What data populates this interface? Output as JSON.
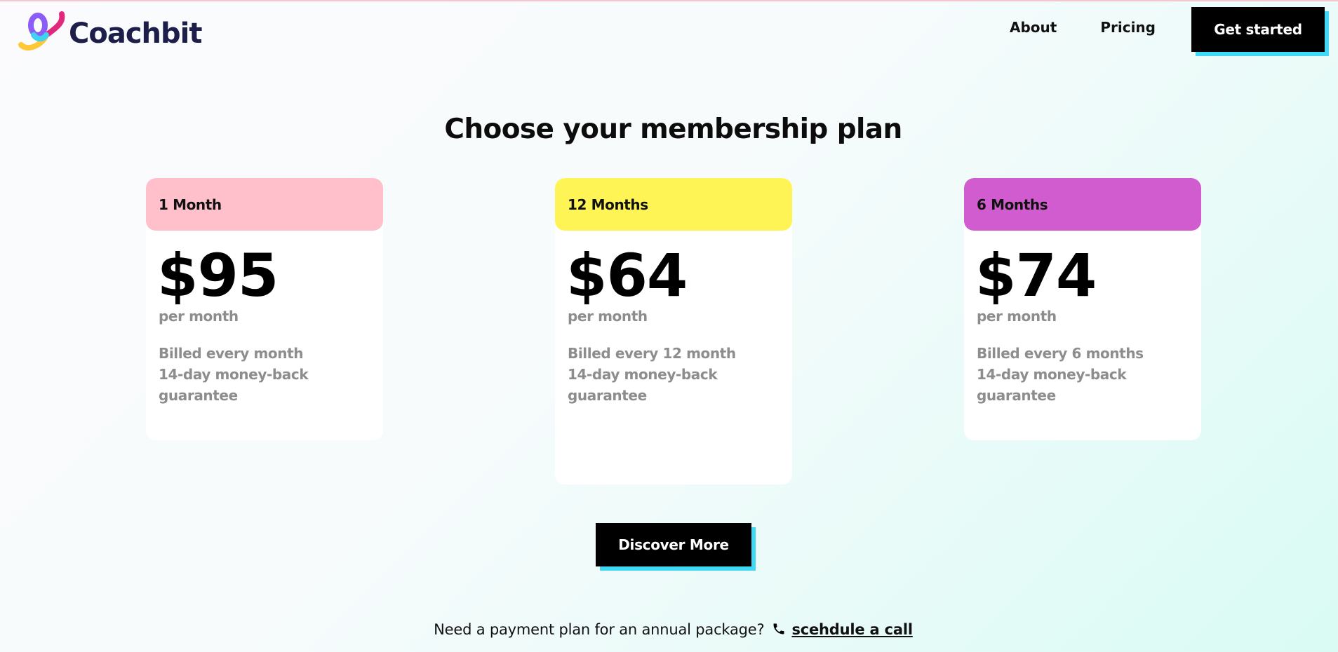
{
  "brand": {
    "name": "Coachbit"
  },
  "nav": {
    "items": [
      {
        "label": "About"
      },
      {
        "label": "Pricing"
      }
    ],
    "cta": "Get started"
  },
  "page": {
    "title": "Choose your membership plan"
  },
  "plans": [
    {
      "label": "1 Month",
      "color": "#ffc0cb",
      "price": "$95",
      "per": "per month",
      "features": [
        "Billed every month",
        "14-day money-back",
        "guarantee"
      ]
    },
    {
      "label": "12 Months",
      "color": "#fef456",
      "price": "$64",
      "per": "per month",
      "features": [
        "Billed every 12 month",
        "14-day money-back",
        "guarantee"
      ]
    },
    {
      "label": "6 Months",
      "color": "#d05ccf",
      "price": "$74",
      "per": "per month",
      "features": [
        "Billed every 6 months",
        "14-day money-back",
        "guarantee"
      ]
    }
  ],
  "discover": {
    "label": "Discover More"
  },
  "note": {
    "text": "Need a payment plan for an annual package?",
    "icon": "phone-icon",
    "link": "scehdule a call"
  },
  "colors": {
    "accent_shadow": "#3fd9f6",
    "brand_text": "#1d1f4a",
    "muted_text": "#8d8d8d"
  }
}
